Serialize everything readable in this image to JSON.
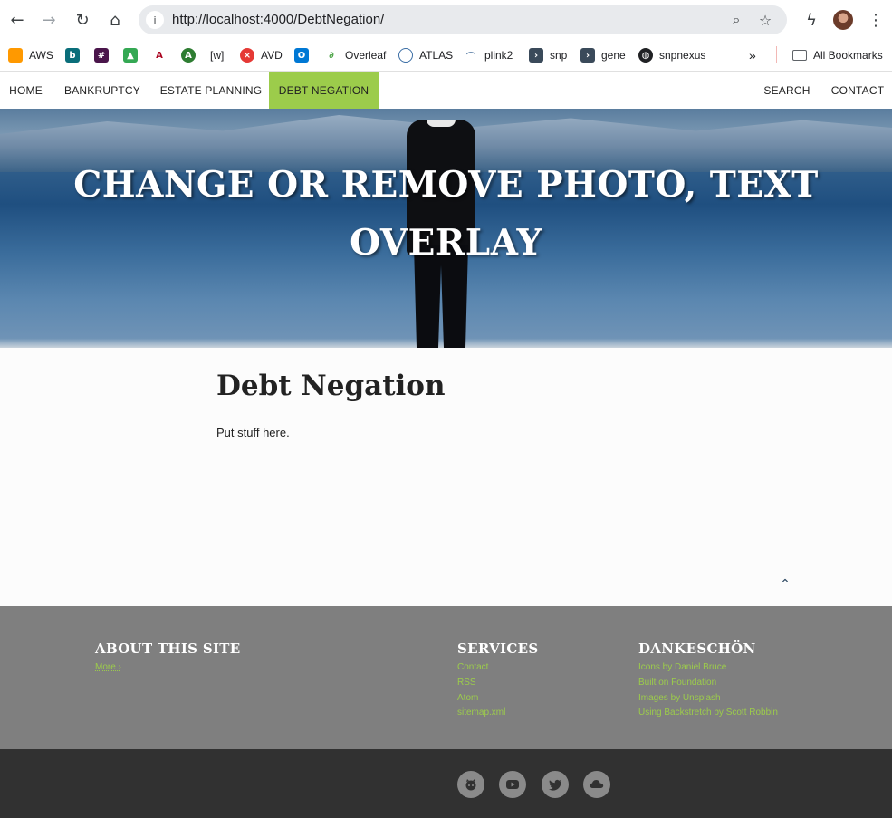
{
  "browser": {
    "url": "http://localhost:4000/DebtNegation/",
    "icons": {
      "back": "arrow-left-icon",
      "forward": "arrow-right-icon",
      "reload": "reload-icon",
      "home": "home-icon",
      "zoom": "zoom-icon",
      "bookmark_star": "star-icon",
      "extensions": "bolt-icon",
      "menu": "kebab-menu-icon"
    },
    "bookmarks": [
      {
        "label": "AWS",
        "color": "#ff9900"
      },
      {
        "label": "",
        "color": "#0a6e7a"
      },
      {
        "label": "",
        "color": "#4a154b"
      },
      {
        "label": "",
        "color": "#34a853"
      },
      {
        "label": "",
        "color": "#ab0520"
      },
      {
        "label": "",
        "color": "#2e7d32"
      },
      {
        "label": "[w]",
        "color": "#ffffff"
      },
      {
        "label": "AVD",
        "color": "#e53935"
      },
      {
        "label": "",
        "color": "#0078d4"
      },
      {
        "label": "Overleaf",
        "color": "#47a141"
      },
      {
        "label": "ATLAS",
        "color": "#3b6ea5"
      },
      {
        "label": "plink2",
        "color": "#5b7fa6"
      },
      {
        "label": "snp",
        "color": "#3a4a5a"
      },
      {
        "label": "gene",
        "color": "#3a4a5a"
      },
      {
        "label": "snpnexus",
        "color": "#202124"
      }
    ],
    "more_bookmarks": "»",
    "all_bookmarks": "All Bookmarks"
  },
  "nav": {
    "items": [
      "HOME",
      "BANKRUPTCY",
      "ESTATE PLANNING",
      "DEBT NEGATION"
    ],
    "active": "DEBT NEGATION",
    "right": [
      "SEARCH",
      "CONTACT"
    ],
    "accent": "#9ccc4b"
  },
  "hero": {
    "title": "CHANGE OR REMOVE PHOTO, TEXT OVERLAY"
  },
  "content": {
    "title": "Debt Negation",
    "body": "Put stuff here.",
    "back_to_top_icon": "chevron-up-icon"
  },
  "footer": {
    "about": {
      "heading": "ABOUT THIS SITE",
      "more": "More ›"
    },
    "services": {
      "heading": "SERVICES",
      "links": [
        "Contact",
        "RSS",
        "Atom",
        "sitemap.xml"
      ]
    },
    "thanks": {
      "heading": "DANKESCHÖN",
      "links": [
        "Icons by Daniel Bruce",
        "Built on Foundation",
        "Images by Unsplash",
        "Using Backstretch by Scott Robbin"
      ]
    },
    "social": [
      "github-icon",
      "youtube-icon",
      "twitter-icon",
      "cloud-icon"
    ]
  }
}
